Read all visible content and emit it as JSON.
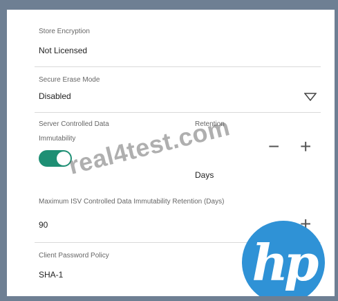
{
  "fields": {
    "store_encryption": {
      "label": "Store Encryption",
      "value": "Not Licensed"
    },
    "secure_erase_mode": {
      "label": "Secure Erase Mode",
      "value": "Disabled"
    },
    "server_controlled_data_immutability": {
      "label_line1": "Server Controlled Data",
      "label_line2": "Immutability",
      "enabled": true
    },
    "retention": {
      "label": "Retention",
      "unit": "Days"
    },
    "max_isv_retention": {
      "label": "Maximum ISV Controlled Data Immutability Retention (Days)",
      "value": "90"
    },
    "client_password_policy": {
      "label": "Client Password Policy",
      "value": "SHA-1"
    }
  },
  "glyphs": {
    "minus": "−",
    "plus": "+"
  },
  "watermark": {
    "text": "real4test.com"
  },
  "logo": {
    "text": "hp",
    "color": "#2f92d6"
  },
  "colors": {
    "toggle_on": "#1e8f74",
    "frame": "#6e7f93"
  }
}
